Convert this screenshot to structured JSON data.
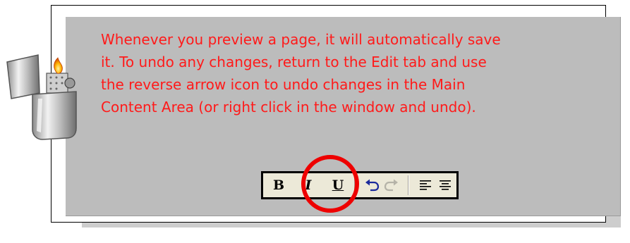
{
  "message": {
    "text": "Whenever you preview a page, it will automatically save\nit. To undo any changes, return to the Edit tab and use\nthe reverse arrow icon to undo changes in the Main\nContent Area (or right click in the window and undo).",
    "color": "#ff1a1a"
  },
  "toolbar": {
    "bold_label": "B",
    "italic_label": "I",
    "underline_label": "U",
    "undo_icon": "undo-arrow-icon",
    "redo_icon": "redo-arrow-icon",
    "align_left_icon": "align-left-icon",
    "align_center_icon": "align-center-icon"
  },
  "highlight": {
    "target": "undo-button",
    "color": "#ee0000"
  },
  "decoration": {
    "icon": "lighter-icon"
  },
  "colors": {
    "panel": "#bcbcbc",
    "shadow": "#cdcdcd",
    "toolbar": "#ece9d8"
  }
}
